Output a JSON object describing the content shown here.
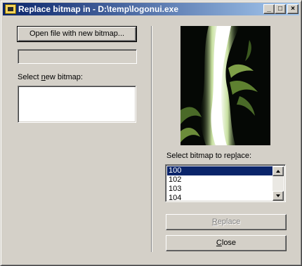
{
  "window": {
    "title": "Replace bitmap in - D:\\temp\\logonui.exe",
    "controls": {
      "minimize": "_",
      "maximize": "□",
      "close": "×"
    }
  },
  "left": {
    "open_button_label": "Open file with new bitmap...",
    "path_field_value": "",
    "select_new_label_prefix": "Select ",
    "select_new_label_accel": "n",
    "select_new_label_suffix": "ew bitmap:"
  },
  "right": {
    "select_replace_label_prefix": "Select bitmap to rep",
    "select_replace_label_accel": "l",
    "select_replace_label_suffix": "ace:",
    "bitmap_list": [
      "100",
      "102",
      "103",
      "104"
    ],
    "selected_index": 0,
    "replace_button_accel": "R",
    "replace_button_rest": "eplace",
    "close_button_accel": "C",
    "close_button_rest": "lose"
  },
  "colors": {
    "face": "#d4d0c8",
    "title_start": "#0a246a",
    "title_end": "#a6caf0",
    "selection": "#0a246a"
  },
  "icons": {
    "title_icon": "app-icon",
    "scroll_up": "arrow-up-icon",
    "scroll_down": "arrow-down-icon"
  }
}
